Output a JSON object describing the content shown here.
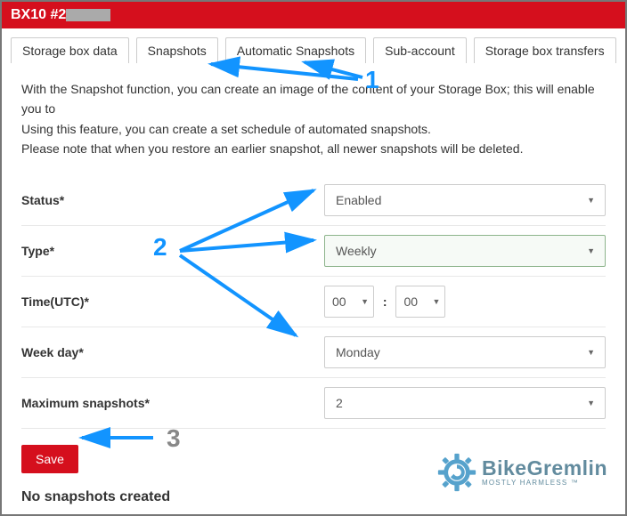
{
  "header": {
    "title_prefix": "BX10 #2"
  },
  "tabs": [
    {
      "label": "Storage box data"
    },
    {
      "label": "Snapshots"
    },
    {
      "label": "Automatic Snapshots"
    },
    {
      "label": "Sub-account"
    },
    {
      "label": "Storage box transfers"
    }
  ],
  "description": {
    "line1": "With the Snapshot function, you can create an image of the content of your Storage Box; this will enable you to",
    "line2": "Using this feature, you can create a set schedule of automated snapshots.",
    "line3": "Please note that when you restore an earlier snapshot, all newer snapshots will be deleted."
  },
  "form": {
    "status": {
      "label": "Status*",
      "value": "Enabled"
    },
    "type": {
      "label": "Type*",
      "value": "Weekly"
    },
    "time": {
      "label": "Time(UTC)*",
      "hour": "00",
      "minute": "00"
    },
    "weekday": {
      "label": "Week day*",
      "value": "Monday"
    },
    "max": {
      "label": "Maximum snapshots*",
      "value": "2"
    },
    "save_label": "Save"
  },
  "footer": {
    "no_snapshots": "No snapshots created"
  },
  "logo": {
    "line1": "BikeGremlin",
    "line2": "MOSTLY HARMLESS ™"
  },
  "annotations": {
    "n1": "1",
    "n2": "2",
    "n3": "3"
  }
}
